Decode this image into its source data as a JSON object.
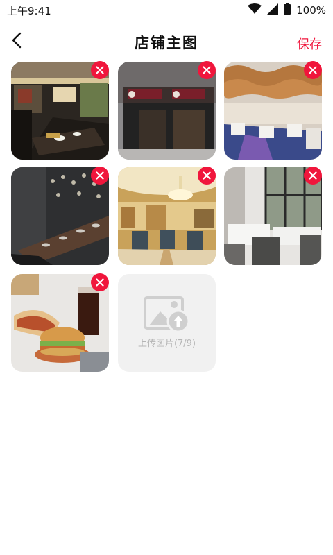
{
  "status_bar": {
    "time": "上午9:41",
    "battery": "100%",
    "icons": [
      "wifi-icon",
      "signal-icon",
      "battery-icon"
    ]
  },
  "header": {
    "title": "店铺主图",
    "save_label": "保存",
    "back_icon": "chevron-left-icon"
  },
  "photos": [
    {
      "subject": "restaurant-dining-room",
      "delete_icon": "close-icon"
    },
    {
      "subject": "restaurant-storefront",
      "delete_icon": "close-icon"
    },
    {
      "subject": "banquet-hall",
      "delete_icon": "close-icon"
    },
    {
      "subject": "long-dining-table",
      "delete_icon": "close-icon"
    },
    {
      "subject": "hotel-restaurant",
      "delete_icon": "close-icon"
    },
    {
      "subject": "white-tablecloth-tables",
      "delete_icon": "close-icon"
    },
    {
      "subject": "burger-wrap-cola",
      "delete_icon": "close-icon"
    }
  ],
  "upload": {
    "label": "上传图片(7/9)",
    "icon": "image-upload-icon"
  },
  "colors": {
    "accent": "#f0163c",
    "upload_bg": "#f1f1f1",
    "upload_text": "#b5b5b5"
  }
}
